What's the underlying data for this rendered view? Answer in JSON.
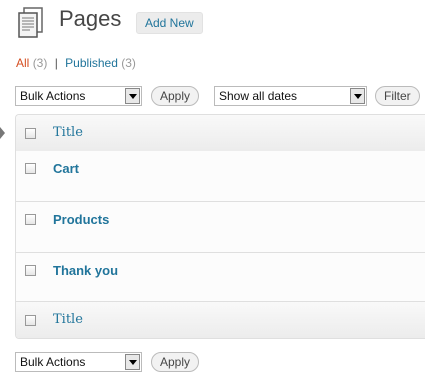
{
  "header": {
    "title": "Pages",
    "add_new": "Add New"
  },
  "filters": {
    "all_label": "All",
    "all_count": "(3)",
    "separator": "|",
    "published_label": "Published",
    "published_count": "(3)"
  },
  "top_nav": {
    "bulk_actions": "Bulk Actions",
    "apply": "Apply",
    "dates": "Show all dates",
    "filter": "Filter"
  },
  "table": {
    "header_title": "Title",
    "footer_title": "Title",
    "rows": [
      {
        "title": "Cart"
      },
      {
        "title": "Products"
      },
      {
        "title": "Thank you"
      }
    ]
  },
  "bottom_nav": {
    "bulk_actions": "Bulk Actions",
    "apply": "Apply"
  },
  "colors": {
    "link": "#21759b",
    "current": "#d54e21",
    "count": "#999999"
  }
}
